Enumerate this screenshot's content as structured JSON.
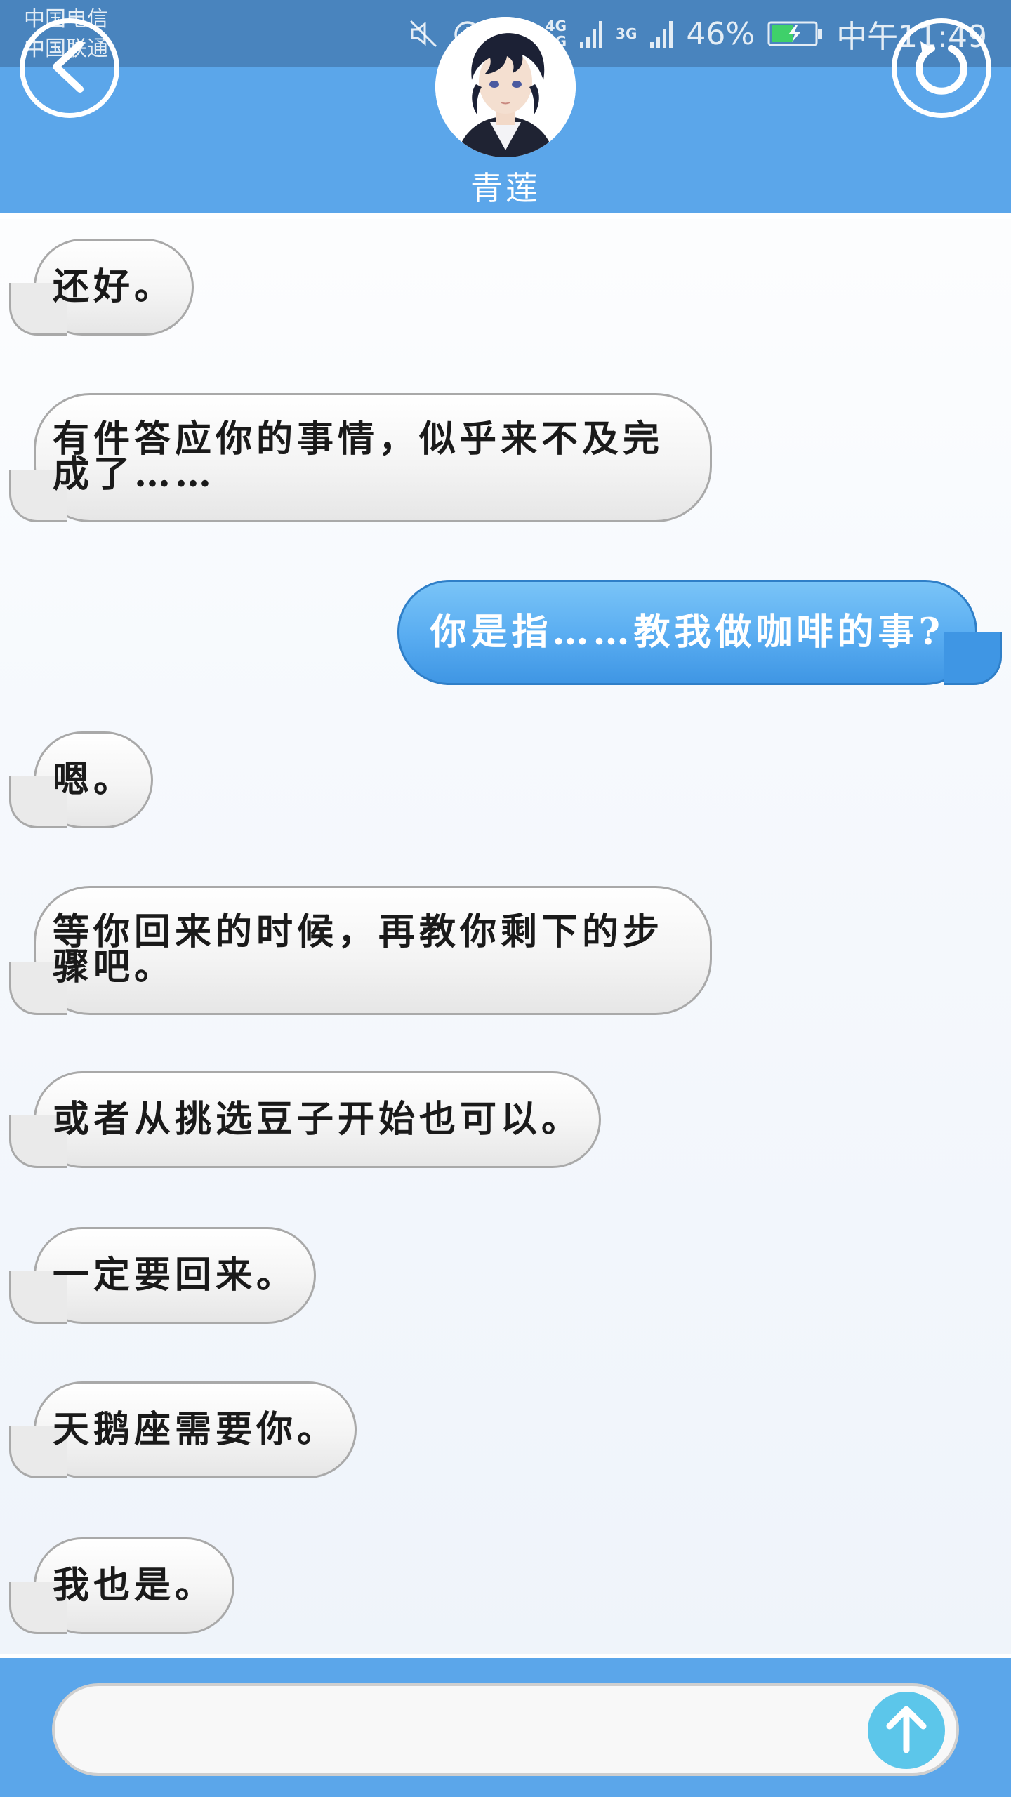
{
  "status_bar": {
    "carriers": [
      "中国电信",
      "中国联通"
    ],
    "network_1": [
      "4G",
      "2G"
    ],
    "network_2": "3G",
    "battery": "46%",
    "time": "中午11:49"
  },
  "header": {
    "contact_name": "青莲"
  },
  "messages": [
    {
      "side": "in",
      "text": "还好。"
    },
    {
      "side": "in",
      "text": "有件答应你的事情，似乎来不及完成了……"
    },
    {
      "side": "out",
      "text": "你是指……教我做咖啡的事?"
    },
    {
      "side": "in",
      "text": "嗯。"
    },
    {
      "side": "in",
      "text": "等你回来的时候，再教你剩下的步骤吧。"
    },
    {
      "side": "in",
      "text": "或者从挑选豆子开始也可以。"
    },
    {
      "side": "in",
      "text": "一定要回来。"
    },
    {
      "side": "in",
      "text": "天鹅座需要你。"
    },
    {
      "side": "in",
      "text": "我也是。"
    }
  ],
  "composer": {
    "value": "",
    "placeholder": ""
  },
  "colors": {
    "header_blue": "#5ba6ea",
    "outgoing_bubble": "#58acf1",
    "send_button": "#5cc6ea"
  }
}
